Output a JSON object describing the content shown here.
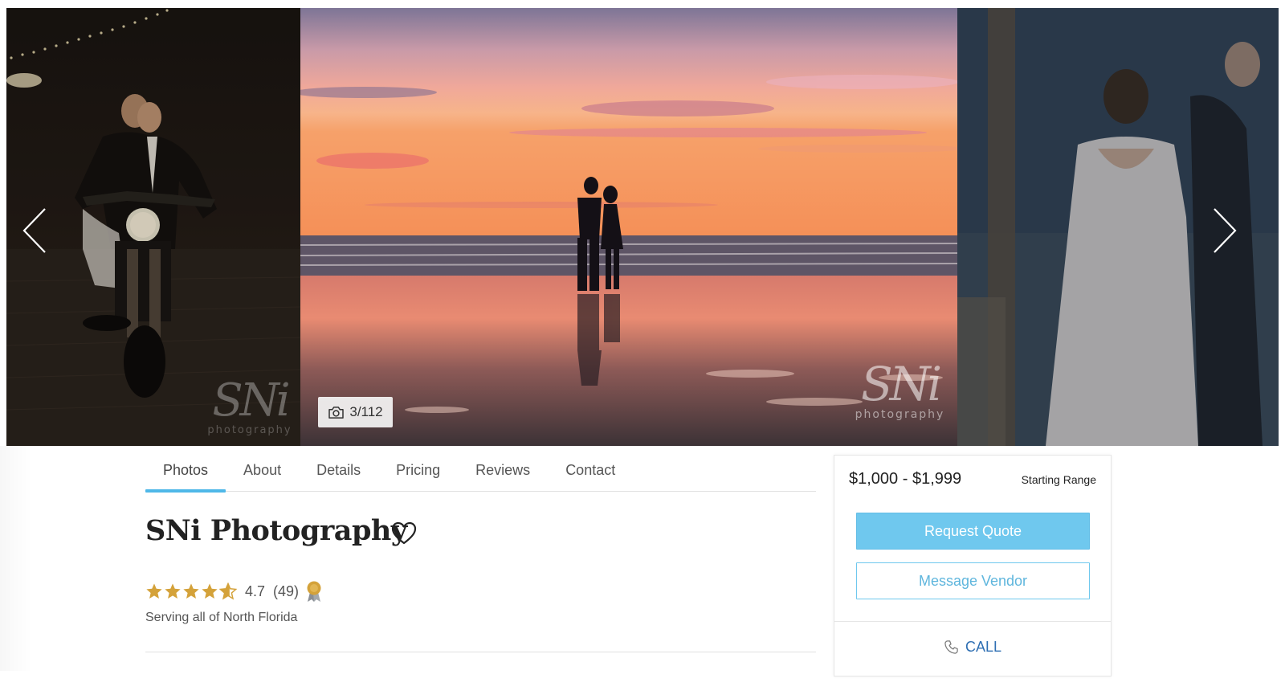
{
  "gallery": {
    "counter": "3/112",
    "counter_icon": "camera-icon",
    "prev_icon": "chevron-left-icon",
    "next_icon": "chevron-right-icon",
    "watermark_logo": "SNi",
    "watermark_sub": "photography"
  },
  "tabs": [
    {
      "label": "Photos",
      "active": true
    },
    {
      "label": "About"
    },
    {
      "label": "Details"
    },
    {
      "label": "Pricing"
    },
    {
      "label": "Reviews"
    },
    {
      "label": "Contact"
    }
  ],
  "vendor": {
    "name": "SNi Photography",
    "favorite_icon": "heart-icon",
    "rating": 4.7,
    "rating_text": "4.7",
    "review_count": "(49)",
    "award_icon": "award-ribbon-icon",
    "service_area": "Serving all of North Florida"
  },
  "quote_card": {
    "price_range": "$1,000 - $1,999",
    "range_label": "Starting Range",
    "request_quote": "Request Quote",
    "message_vendor": "Message Vendor",
    "call_label": "CALL",
    "call_icon": "phone-icon"
  },
  "colors": {
    "accent": "#6fc8ee",
    "tab_underline": "#4fb8e8",
    "star": "#d4a23a",
    "call_link": "#2f6fb3"
  }
}
